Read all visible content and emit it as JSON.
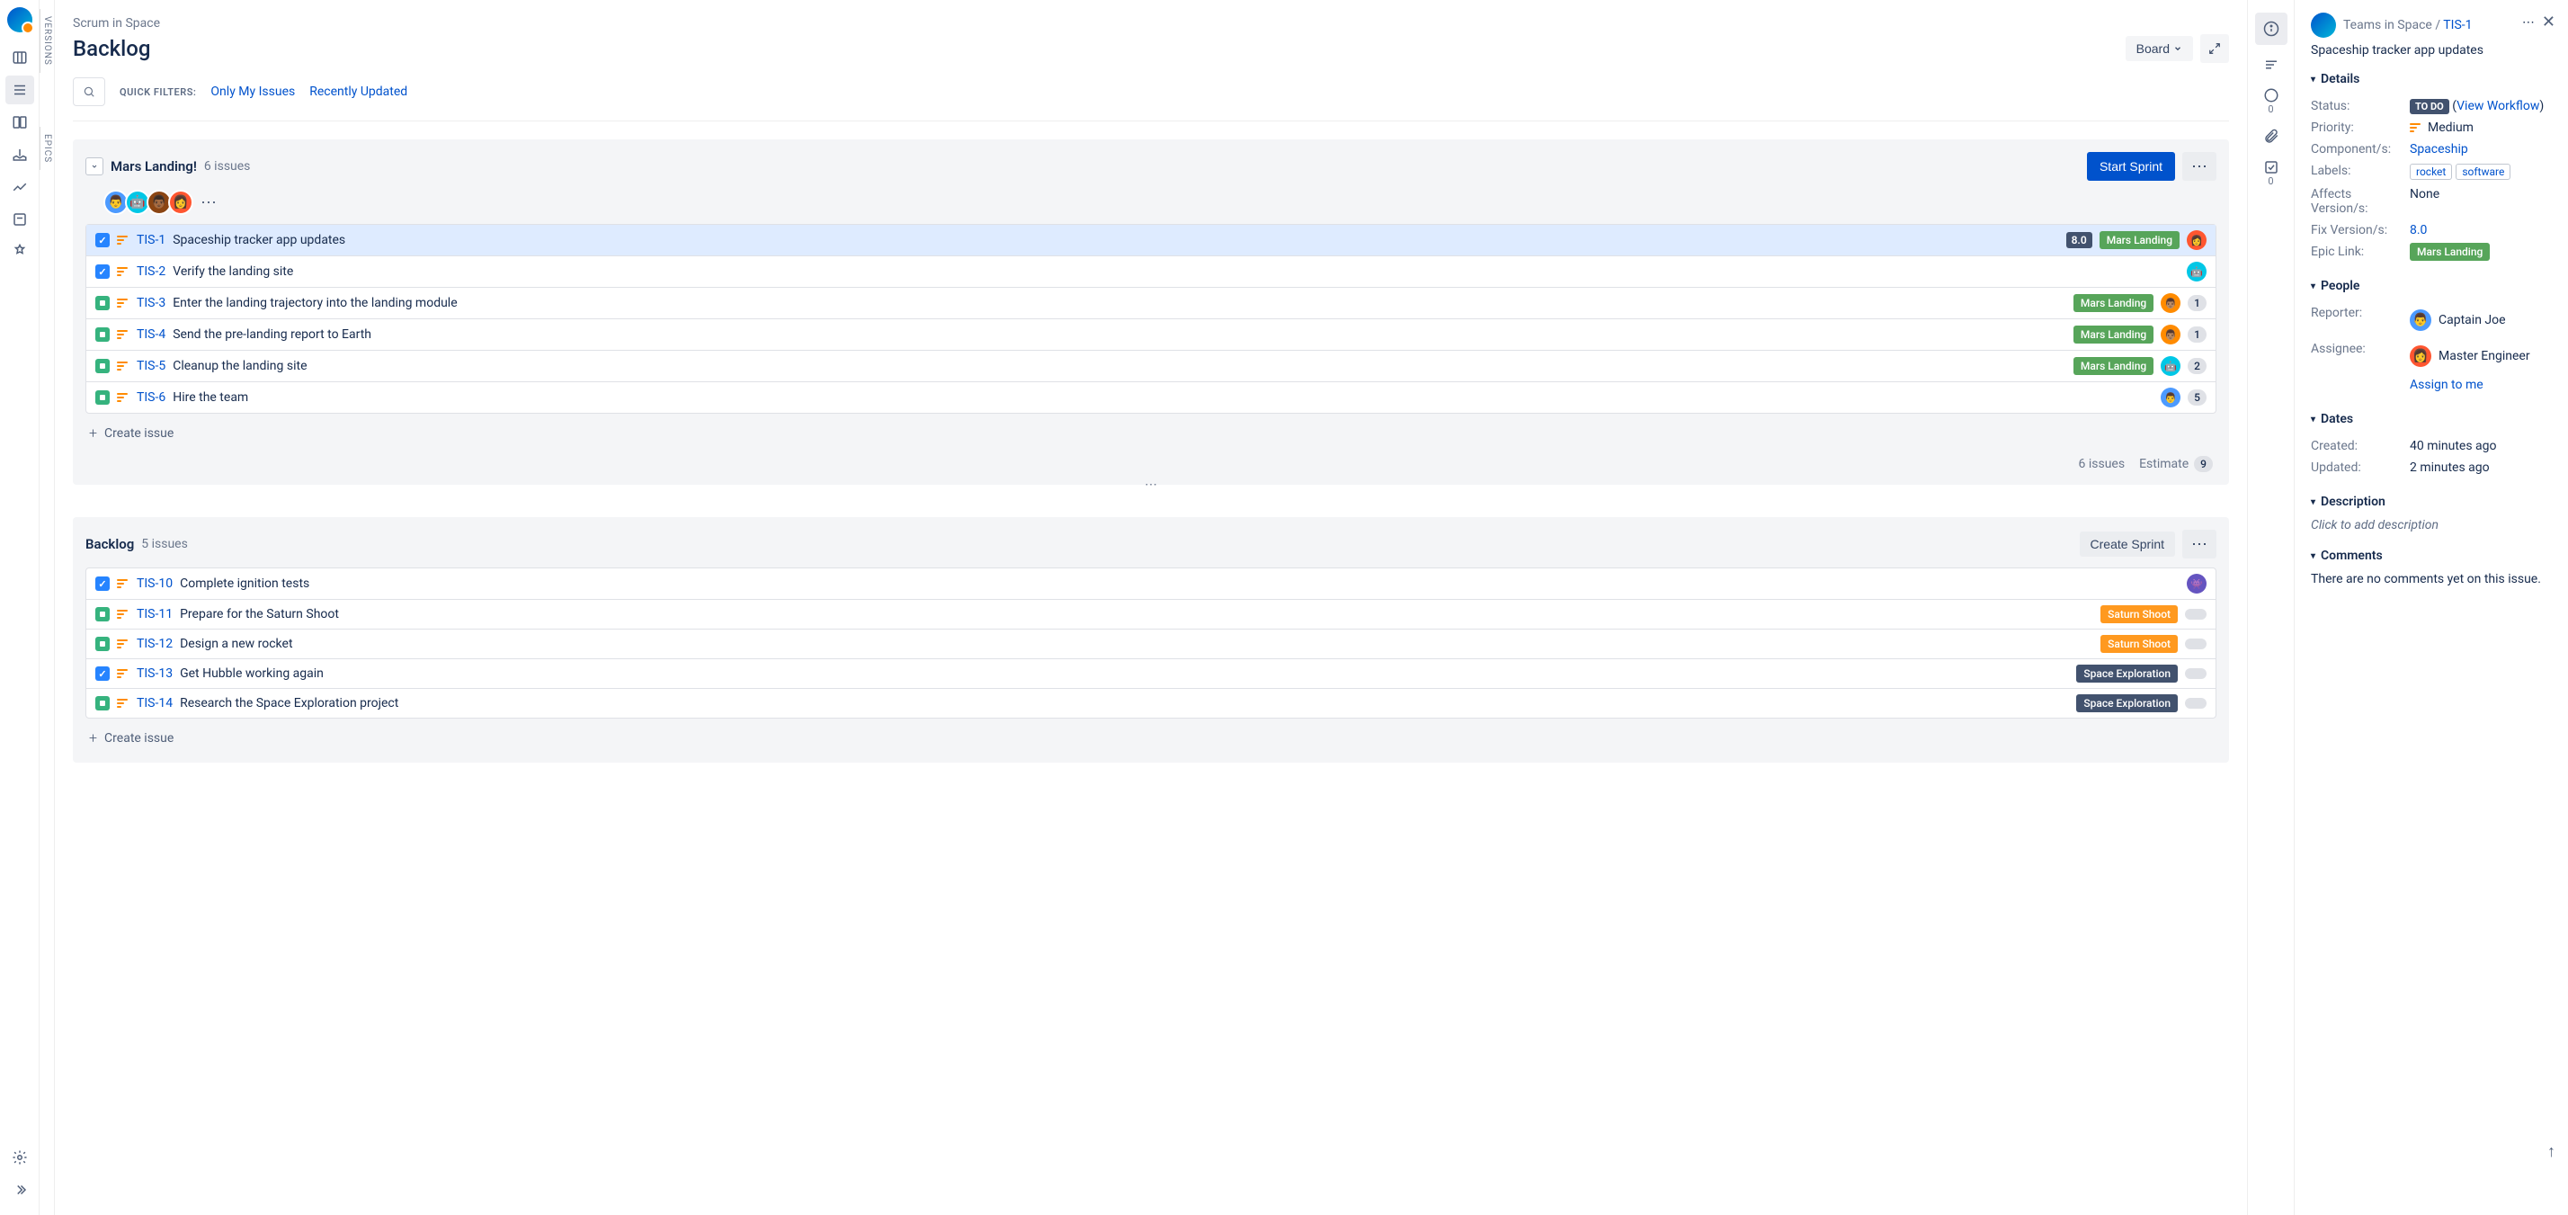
{
  "project_name": "Scrum in Space",
  "page_title": "Backlog",
  "header": {
    "board_button": "Board"
  },
  "filters": {
    "label": "QUICK FILTERS:",
    "only_my": "Only My Issues",
    "recently": "Recently Updated"
  },
  "vertical_tabs": {
    "versions": "VERSIONS",
    "epics": "EPICS"
  },
  "sprint": {
    "title": "Mars Landing!",
    "count_text": "6 issues",
    "start_button": "Start Sprint",
    "footer_issues": "6 issues",
    "footer_estimate_label": "Estimate",
    "footer_estimate_value": "9",
    "create_issue": "Create issue",
    "issues": [
      {
        "key": "TIS-1",
        "summary": "Spaceship tracker app updates",
        "type": "task",
        "estimate": "8.0",
        "epic": "Mars Landing",
        "epic_color": "green",
        "avatar": "red",
        "selected": true
      },
      {
        "key": "TIS-2",
        "summary": "Verify the landing site",
        "type": "task",
        "avatar": "teal"
      },
      {
        "key": "TIS-3",
        "summary": "Enter the landing trajectory into the landing module",
        "type": "story",
        "epic": "Mars Landing",
        "epic_color": "green",
        "avatar": "orange",
        "count": "1"
      },
      {
        "key": "TIS-4",
        "summary": "Send the pre-landing report to Earth",
        "type": "story",
        "epic": "Mars Landing",
        "epic_color": "green",
        "avatar": "orange",
        "count": "1"
      },
      {
        "key": "TIS-5",
        "summary": "Cleanup the landing site",
        "type": "story",
        "epic": "Mars Landing",
        "epic_color": "green",
        "avatar": "teal",
        "count": "2"
      },
      {
        "key": "TIS-6",
        "summary": "Hire the team",
        "type": "story",
        "avatar": "blue",
        "count": "5"
      }
    ]
  },
  "backlog": {
    "title": "Backlog",
    "count_text": "5 issues",
    "create_sprint_button": "Create Sprint",
    "create_issue": "Create issue",
    "issues": [
      {
        "key": "TIS-10",
        "summary": "Complete ignition tests",
        "type": "task",
        "avatar": "purple"
      },
      {
        "key": "TIS-11",
        "summary": "Prepare for the Saturn Shoot",
        "type": "story",
        "epic": "Saturn Shoot",
        "epic_color": "orange",
        "unassigned": true
      },
      {
        "key": "TIS-12",
        "summary": "Design a new rocket",
        "type": "story",
        "epic": "Saturn Shoot",
        "epic_color": "orange",
        "unassigned": true
      },
      {
        "key": "TIS-13",
        "summary": "Get Hubble working again",
        "type": "task",
        "epic": "Space Exploration",
        "epic_color": "dark",
        "unassigned": true
      },
      {
        "key": "TIS-14",
        "summary": "Research the Space Exploration project",
        "type": "story",
        "epic": "Space Exploration",
        "epic_color": "dark",
        "unassigned": true
      }
    ]
  },
  "details": {
    "breadcrumb_project": "Teams in Space",
    "breadcrumb_sep": " / ",
    "issue_key": "TIS-1",
    "summary": "Spaceship tracker app updates",
    "sections": {
      "details": "Details",
      "people": "People",
      "dates": "Dates",
      "description": "Description",
      "comments": "Comments"
    },
    "fields": {
      "status_label": "Status:",
      "status_value": "TO DO",
      "view_workflow": "View Workflow",
      "priority_label": "Priority:",
      "priority_value": "Medium",
      "components_label": "Component/s:",
      "components_value": "Spaceship",
      "labels_label": "Labels:",
      "labels": [
        "rocket",
        "software"
      ],
      "affects_label": "Affects Version/s:",
      "affects_value": "None",
      "fix_label": "Fix Version/s:",
      "fix_value": "8.0",
      "epic_label": "Epic Link:",
      "epic_value": "Mars Landing"
    },
    "people": {
      "reporter_label": "Reporter:",
      "reporter_value": "Captain Joe",
      "assignee_label": "Assignee:",
      "assignee_value": "Master Engineer",
      "assign_to_me": "Assign to me"
    },
    "dates": {
      "created_label": "Created:",
      "created_value": "40 minutes ago",
      "updated_label": "Updated:",
      "updated_value": "2 minutes ago"
    },
    "description_hint": "Click to add description",
    "comments_empty": "There are no comments yet on this issue.",
    "side_counts": {
      "comments": "0",
      "subtasks": "0"
    }
  }
}
